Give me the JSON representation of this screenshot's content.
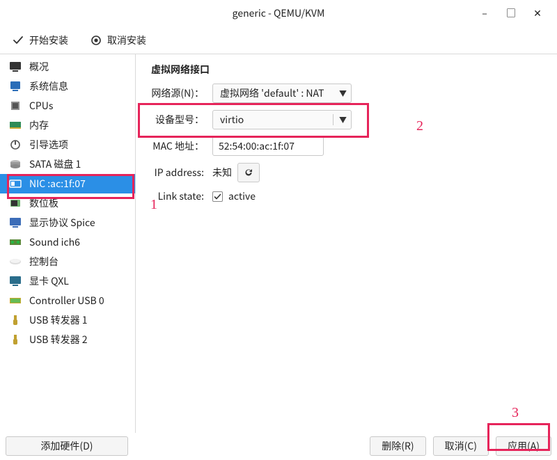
{
  "window": {
    "title": "generic - QEMU/KVM"
  },
  "toolbar": {
    "begin_install": "开始安装",
    "cancel_install": "取消安装"
  },
  "sidebar": {
    "items": [
      {
        "label": "概况",
        "icon": "monitor-icon"
      },
      {
        "label": "系统信息",
        "icon": "info-icon"
      },
      {
        "label": "CPUs",
        "icon": "cpu-icon"
      },
      {
        "label": "内存",
        "icon": "memory-icon"
      },
      {
        "label": "引导选项",
        "icon": "boot-icon"
      },
      {
        "label": "SATA 磁盘 1",
        "icon": "disk-icon"
      },
      {
        "label": "NIC :ac:1f:07",
        "icon": "nic-icon"
      },
      {
        "label": "数位板",
        "icon": "tablet-icon"
      },
      {
        "label": "显示协议 Spice",
        "icon": "display-icon"
      },
      {
        "label": "Sound ich6",
        "icon": "sound-icon"
      },
      {
        "label": "控制台",
        "icon": "console-icon"
      },
      {
        "label": "显卡 QXL",
        "icon": "video-icon"
      },
      {
        "label": "Controller USB 0",
        "icon": "usb-controller-icon"
      },
      {
        "label": "USB 转发器 1",
        "icon": "usb-redir-icon"
      },
      {
        "label": "USB 转发器 2",
        "icon": "usb-redir-icon"
      }
    ],
    "selected_index": 6,
    "add_hardware": "添加硬件(D)"
  },
  "panel": {
    "title": "虚拟网络接口",
    "fields": {
      "network_source_label": "网络源(N)：",
      "network_source_value": "虚拟网络 'default' : NAT",
      "device_model_label": "设备型号：",
      "device_model_value": "virtio",
      "mac_label": "MAC 地址：",
      "mac_value": "52:54:00:ac:1f:07",
      "ip_label": "IP address:",
      "ip_value": "未知",
      "link_state_label": "Link state:",
      "link_state_value": "active",
      "link_state_checked": true
    }
  },
  "buttons": {
    "delete": "删除(R)",
    "cancel": "取消(C)",
    "apply": "应用(A)"
  },
  "annotations": {
    "n1": "1",
    "n2": "2",
    "n3": "3"
  }
}
